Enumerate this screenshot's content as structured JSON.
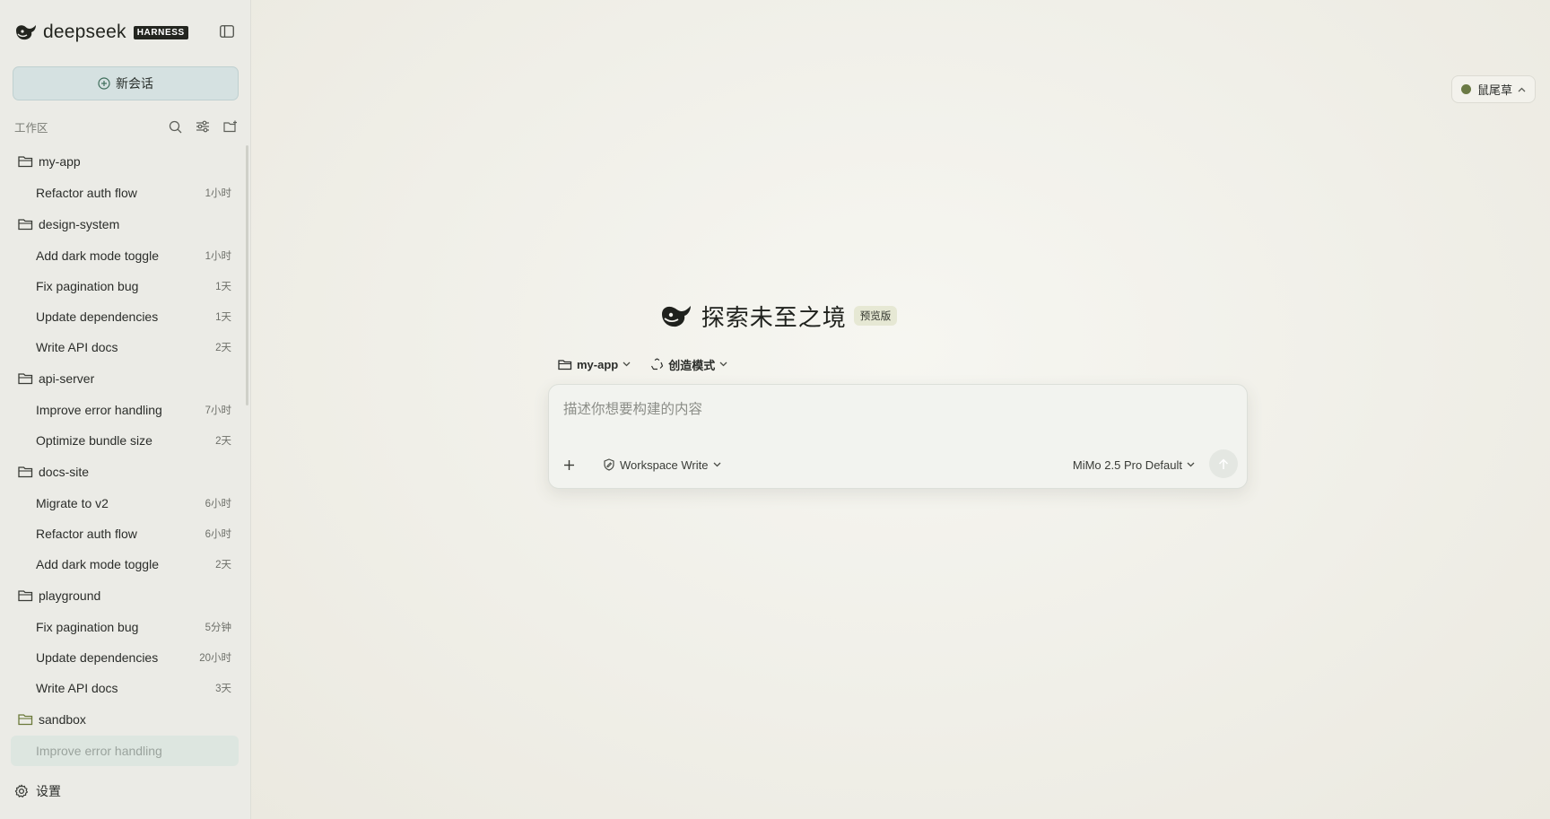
{
  "brand": {
    "name": "deepseek",
    "badge": "HARNESS"
  },
  "sidebar": {
    "new_chat_label": "新会话",
    "workspace_label": "工作区",
    "groups": [
      {
        "name": "my-app",
        "items": [
          {
            "title": "Refactor auth flow",
            "time": "1小时"
          }
        ]
      },
      {
        "name": "design-system",
        "items": [
          {
            "title": "Add dark mode toggle",
            "time": "1小时"
          },
          {
            "title": "Fix pagination bug",
            "time": "1天"
          },
          {
            "title": "Update dependencies",
            "time": "1天"
          },
          {
            "title": "Write API docs",
            "time": "2天"
          }
        ]
      },
      {
        "name": "api-server",
        "items": [
          {
            "title": "Improve error handling",
            "time": "7小时"
          },
          {
            "title": "Optimize bundle size",
            "time": "2天"
          }
        ]
      },
      {
        "name": "docs-site",
        "items": [
          {
            "title": "Migrate to v2",
            "time": "6小时"
          },
          {
            "title": "Refactor auth flow",
            "time": "6小时"
          },
          {
            "title": "Add dark mode toggle",
            "time": "2天"
          }
        ]
      },
      {
        "name": "playground",
        "items": [
          {
            "title": "Fix pagination bug",
            "time": "5分钟"
          },
          {
            "title": "Update dependencies",
            "time": "20小时"
          },
          {
            "title": "Write API docs",
            "time": "3天"
          }
        ]
      },
      {
        "name": "sandbox",
        "items": [
          {
            "title": "Improve error handling",
            "time": "",
            "active": true
          }
        ]
      }
    ],
    "settings_label": "设置"
  },
  "theme": {
    "label": "鼠尾草",
    "dot_color": "#6b7a45"
  },
  "hero": {
    "title": "探索未至之境",
    "badge": "预览版"
  },
  "controls": {
    "project": "my-app",
    "mode": "创造模式"
  },
  "composer": {
    "placeholder": "描述你想要构建的内容",
    "permission": "Workspace Write",
    "model": "MiMo 2.5 Pro Default"
  },
  "colors": {
    "accent": "#d5e1e1",
    "folder_icon": "#3a3c37",
    "sandbox_folder_icon": "#6b7a3a"
  }
}
